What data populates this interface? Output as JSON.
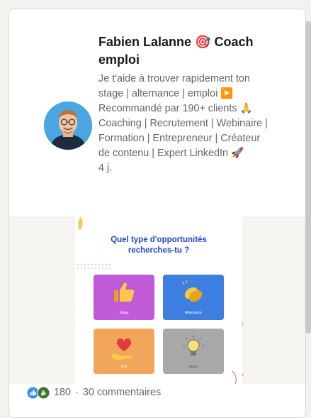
{
  "post": {
    "author_name": "Fabien Lalanne",
    "author_name_suffix": "Coach emploi",
    "author_emoji": "🎯",
    "headline": "Je t'aide à trouver rapidement ton stage | alternance | emploi ▶️ Recommandé par 190+ clients 🙏 Coaching | Recrutement | Webinaire | Formation | Entrepreneur | Créateur de contenu | Expert LinkedIn 🚀",
    "age": "4 j."
  },
  "graphic": {
    "title_line1": "Quel type d'opportunités",
    "title_line2": "recherches-tu ?",
    "tiles": [
      {
        "label": "Stage",
        "color": "#c15ad8"
      },
      {
        "label": "Alternance",
        "color": "#3c7fe0"
      },
      {
        "label": "CDI",
        "color": "#f0a55a"
      },
      {
        "label": "Autre",
        "color": "#a8a8a8"
      }
    ]
  },
  "social": {
    "reaction_count": "180",
    "separator": "·",
    "comments": "30 commentaires"
  },
  "colors": {
    "like_blue": "#378fe9",
    "celebrate_green": "#44712e"
  }
}
